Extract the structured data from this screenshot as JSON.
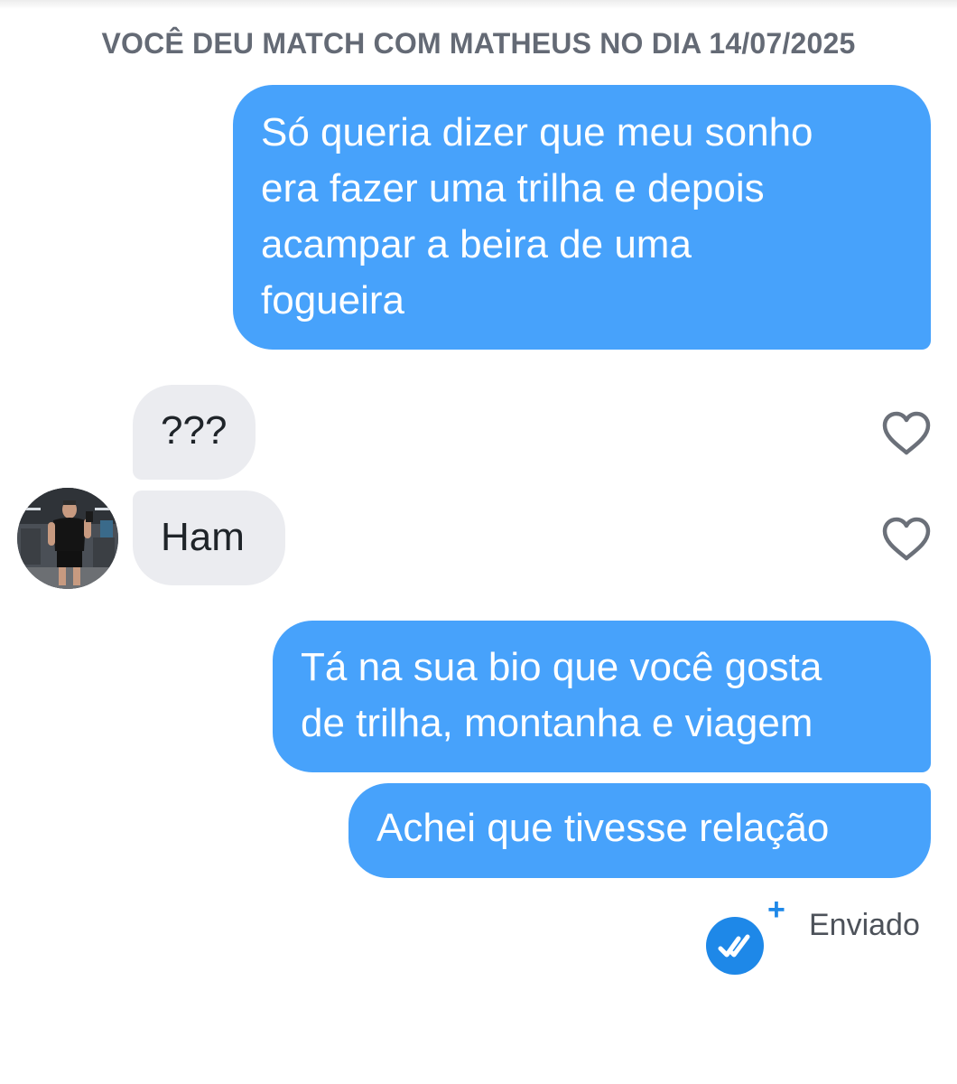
{
  "chat": {
    "match_header": "VOCÊ DEU MATCH COM MATHEUS NO DIA 14/07/2025",
    "messages": [
      {
        "direction": "sent",
        "lines": [
          "Só queria dizer que meu sonho",
          "era fazer uma trilha e depois",
          "acampar a beira de uma",
          "fogueira"
        ]
      },
      {
        "direction": "received",
        "lines": [
          "???"
        ],
        "liked": false
      },
      {
        "direction": "received",
        "lines": [
          "Ham"
        ],
        "liked": false
      },
      {
        "direction": "sent",
        "lines": [
          "Tá na sua bio que você gosta",
          "de trilha, montanha e viagem"
        ]
      },
      {
        "direction": "sent",
        "lines": [
          "Achei que tivesse relação"
        ]
      }
    ],
    "status": {
      "plus": "+",
      "label": "Enviado"
    }
  },
  "icons": {
    "heart": "heart-outline-icon",
    "status": "double-check-icon",
    "avatar": "profile-photo"
  },
  "colors": {
    "sent_bubble": "#47a2fb",
    "received_bubble": "#ebecf0",
    "header_text": "#646a75",
    "status_blue": "#1e88e8"
  }
}
